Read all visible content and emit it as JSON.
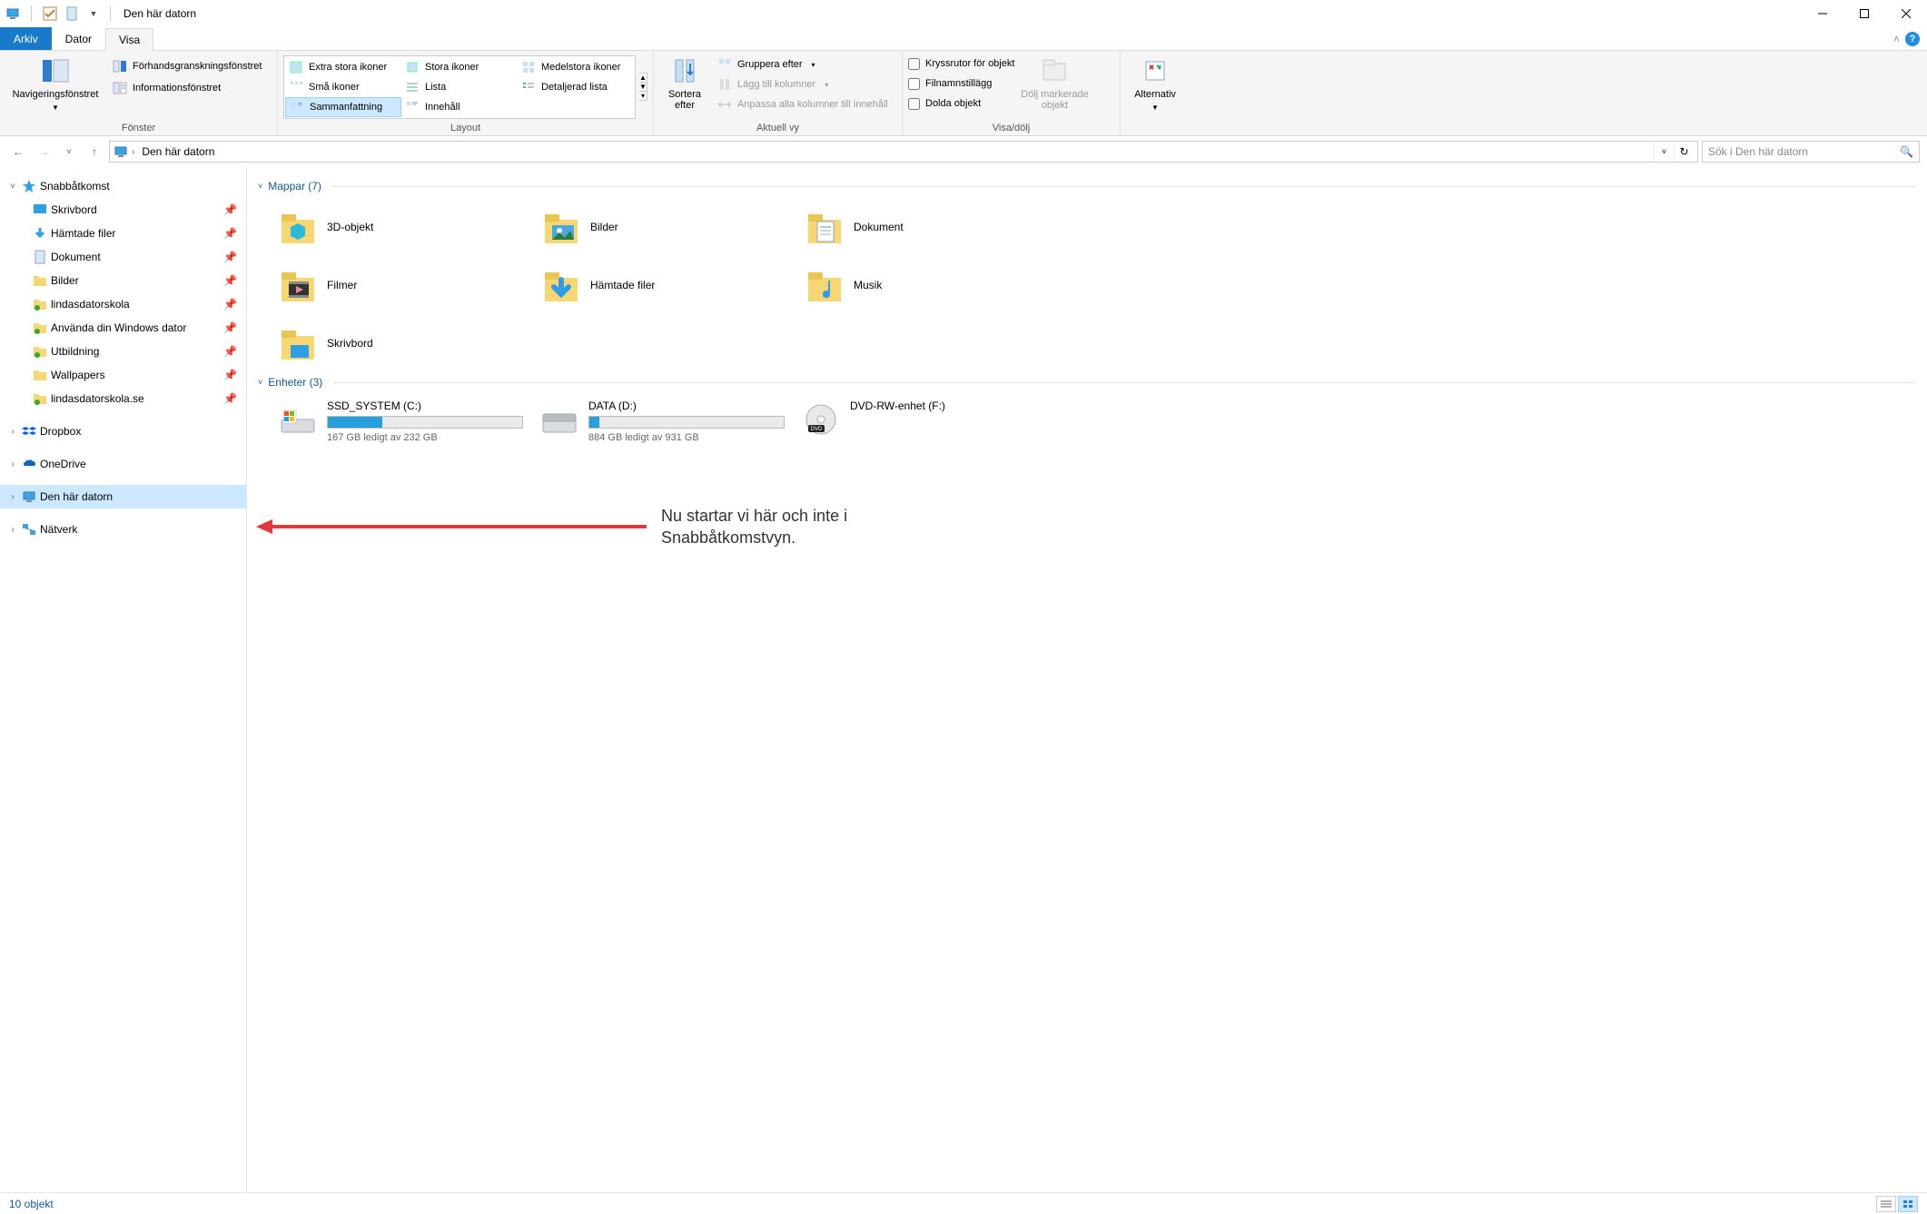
{
  "title": "Den här datorn",
  "menu": {
    "file": "Arkiv",
    "dator": "Dator",
    "visa": "Visa"
  },
  "ribbon": {
    "groups": {
      "fonster": {
        "label": "Fönster",
        "nav": "Navigeringsfönstret",
        "preview": "Förhandsgranskningsfönstret",
        "info": "Informationsfönstret"
      },
      "layout": {
        "label": "Layout",
        "items": {
          "xl": "Extra stora ikoner",
          "l": "Stora ikoner",
          "m": "Medelstora ikoner",
          "s": "Små ikoner",
          "list": "Lista",
          "detail": "Detaljerad lista",
          "tiles": "Sammanfattning",
          "content": "Innehåll"
        }
      },
      "aktuell": {
        "label": "Aktuell vy",
        "sort": "Sortera efter",
        "group": "Gruppera efter",
        "addcol": "Lägg till kolumner",
        "fitcol": "Anpassa alla kolumner till innehåll"
      },
      "visa_dolj": {
        "label": "Visa/dölj",
        "chk1": "Kryssrutor för objekt",
        "chk2": "Filnamnstillägg",
        "chk3": "Dolda objekt",
        "hide": "Dölj markerade objekt"
      },
      "alternativ": "Alternativ"
    }
  },
  "address": {
    "crumb": "Den här datorn"
  },
  "search": {
    "placeholder": "Sök i Den här datorn"
  },
  "tree": {
    "quick": "Snabbåtkomst",
    "items": {
      "desktop": "Skrivbord",
      "downloads": "Hämtade filer",
      "documents": "Dokument",
      "pictures": "Bilder",
      "lds": "lindasdatorskola",
      "anvand": "Använda din Windows dator",
      "utbild": "Utbildning",
      "wallpapers": "Wallpapers",
      "ldsse": "lindasdatorskola.se"
    },
    "dropbox": "Dropbox",
    "onedrive": "OneDrive",
    "thispc": "Den här datorn",
    "network": "Nätverk"
  },
  "sections": {
    "folders": "Mappar (7)",
    "devices": "Enheter (3)"
  },
  "folders": {
    "obj3d": "3D-objekt",
    "pictures": "Bilder",
    "documents": "Dokument",
    "videos": "Filmer",
    "downloads": "Hämtade filer",
    "music": "Musik",
    "desktop": "Skrivbord"
  },
  "drives": {
    "c": {
      "name": "SSD_SYSTEM (C:)",
      "free": "167 GB ledigt av 232 GB",
      "pct": 28
    },
    "d": {
      "name": "DATA (D:)",
      "free": "884 GB ledigt av 931 GB",
      "pct": 5
    },
    "f": {
      "name": "DVD-RW-enhet (F:)"
    }
  },
  "annotation": "Nu startar vi här och inte i Snabbåtkomstvyn.",
  "status": "10 objekt"
}
